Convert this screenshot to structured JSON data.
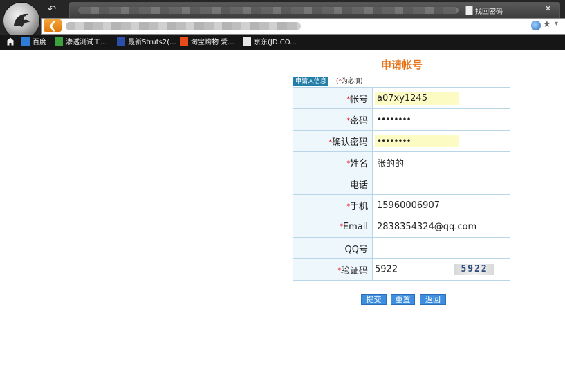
{
  "browser": {
    "tab_title": "找回密码",
    "tab_close": "×",
    "back_icon": "↶",
    "back_button": "❮",
    "star": "★",
    "dropdown": "▾"
  },
  "bookmarks": [
    {
      "label": "百度",
      "icon_color": "#2f7bd5"
    },
    {
      "label": "渗透测试工...",
      "icon_color": "#3da13d"
    },
    {
      "label": "最新Struts2(...",
      "icon_color": "#2b4fa8"
    },
    {
      "label": "淘宝购物 爱...",
      "icon_color": "#e84b1a"
    },
    {
      "label": "京东(JD.CO...",
      "icon_color": "#e8e8e8"
    }
  ],
  "page": {
    "title": "申请帐号",
    "section_label": "申请人信息",
    "required_note_prefix": "(",
    "required_note_star": "*",
    "required_note_text": "为必填)"
  },
  "form": {
    "rows": [
      {
        "label": "帐号",
        "required": true,
        "value": "a07xy1245",
        "highlight": true
      },
      {
        "label": "密码",
        "required": true,
        "value": "••••••••",
        "highlight": false
      },
      {
        "label": "确认密码",
        "required": true,
        "value": "••••••••",
        "highlight": true
      },
      {
        "label": "姓名",
        "required": true,
        "value": "张的的",
        "highlight": false
      },
      {
        "label": "电话",
        "required": false,
        "value": "",
        "highlight": false
      },
      {
        "label": "手机",
        "required": true,
        "value": "15960006907",
        "highlight": false
      },
      {
        "label": "Email",
        "required": true,
        "value": "2838354324@qq.com",
        "highlight": false
      },
      {
        "label": "QQ号",
        "required": false,
        "value": "",
        "highlight": false
      },
      {
        "label": "验证码",
        "required": true,
        "value": "5922",
        "highlight": false
      }
    ],
    "captcha_text": "5922"
  },
  "buttons": {
    "submit": "提交",
    "reset": "重置",
    "back": "返回"
  }
}
